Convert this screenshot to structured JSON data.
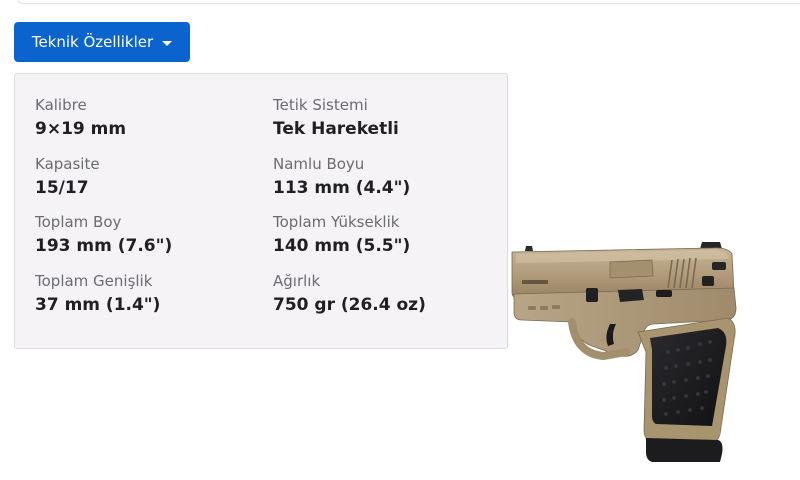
{
  "dropdown": {
    "label": "Teknik Özellikler"
  },
  "specs": [
    {
      "label": "Kalibre",
      "value": "9×19 mm"
    },
    {
      "label": "Tetik Sistemi",
      "value": "Tek Hareketli"
    },
    {
      "label": "Kapasite",
      "value": "15/17"
    },
    {
      "label": "Namlu Boyu",
      "value": "113 mm (4.4\")"
    },
    {
      "label": "Toplam Boy",
      "value": "193 mm (7.6\")"
    },
    {
      "label": "Toplam Yükseklik",
      "value": "140 mm (5.5\")"
    },
    {
      "label": "Toplam Genişlik",
      "value": "37 mm (1.4\")"
    },
    {
      "label": "Ağırlık",
      "value": "750 gr (26.4 oz)"
    }
  ],
  "colors": {
    "button": "#0b63ce",
    "panel": "#f6f3f7",
    "label": "#6b6b72",
    "value": "#1f1f24",
    "frame_tan": "#b29e80",
    "grip_black": "#1b1b1e"
  },
  "icons": {
    "dropdown": "caret-down-icon"
  }
}
